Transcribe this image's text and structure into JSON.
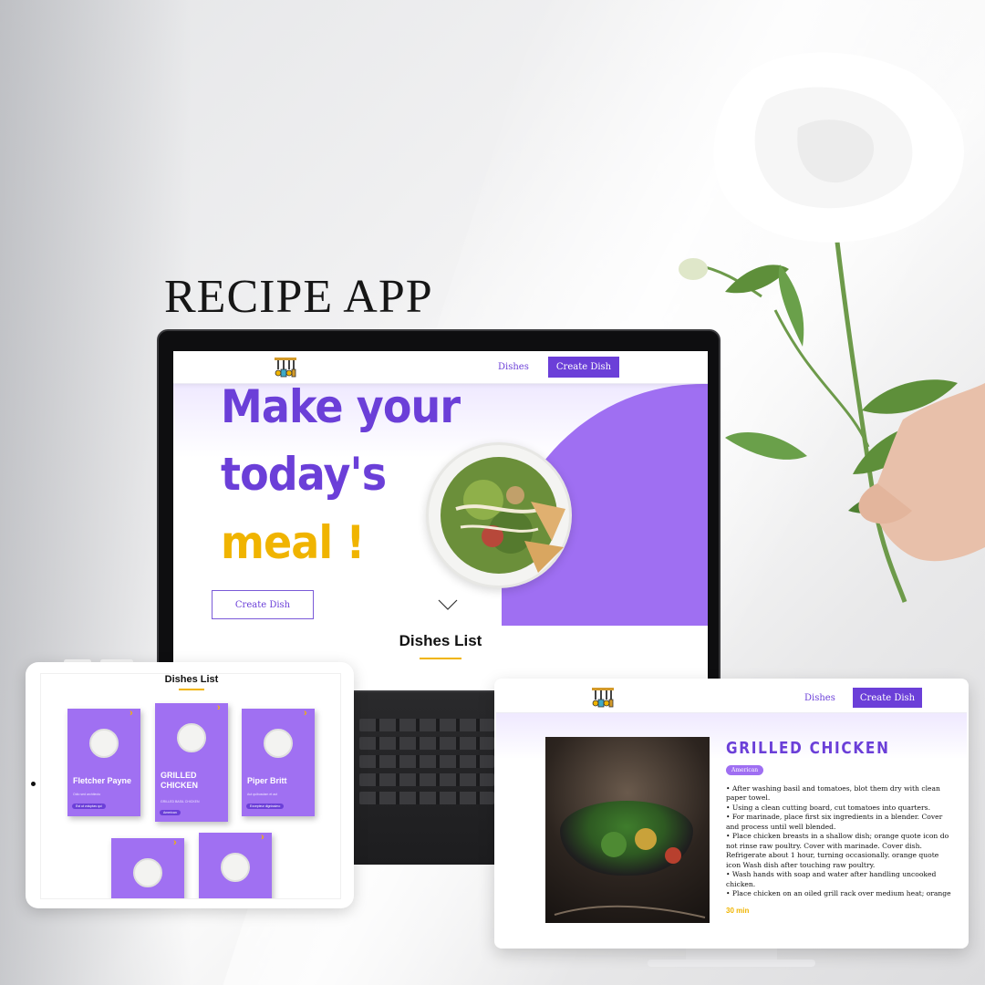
{
  "brand": {
    "title": "RECIPE APP"
  },
  "colors": {
    "accent": "#6b3fd8",
    "accent_light": "#9f6ff2",
    "highlight": "#f0b400"
  },
  "laptop": {
    "nav": {
      "logo_icon": "kitchen-utensils-icon",
      "dishes_link": "Dishes",
      "create_button": "Create Dish"
    },
    "hero": {
      "line1": "Make your",
      "line2": "today's",
      "line3": "meal !",
      "create_button": "Create Dish",
      "scroll_icon": "chevron-down-icon"
    },
    "section_title": "Dishes List"
  },
  "tablet": {
    "title": "Dishes List",
    "cards": [
      {
        "title": "Fletcher Payne",
        "sub": "Odio sed architecto",
        "tag": "Est ut voluptas qui"
      },
      {
        "title": "GRILLED CHICKEN",
        "sub": "GRILLED BASIL CHICKEN",
        "tag": "American"
      },
      {
        "title": "Piper Britt",
        "sub": "Aut quibusdam et aut",
        "tag": "Excepteur dignissimo"
      },
      {
        "title": "",
        "sub": "",
        "tag": ""
      },
      {
        "title": "",
        "sub": "",
        "tag": ""
      }
    ]
  },
  "monitor": {
    "nav": {
      "logo_icon": "kitchen-utensils-icon",
      "dishes_link": "Dishes",
      "create_button": "Create Dish"
    },
    "dish": {
      "title": "GRILLED CHICKEN",
      "cuisine": "American",
      "steps": [
        "•   After washing basil and tomatoes, blot them dry with clean paper towel.",
        "•   Using a clean cutting board, cut tomatoes into quarters.",
        "•   For marinade, place first six ingredients in a blender. Cover and process until well blended.",
        "•   Place chicken breasts in a shallow dish; orange quote icon do not rinse raw poultry. Cover with marinade. Cover dish. Refrigerate about 1 hour, turning occasionally. orange quote icon Wash dish after touching raw poultry.",
        "•   Wash hands with soap and water after handling uncooked chicken.",
        "•   Place chicken on an oiled grill rack over medium heat; orange"
      ],
      "time": "30 min"
    }
  }
}
